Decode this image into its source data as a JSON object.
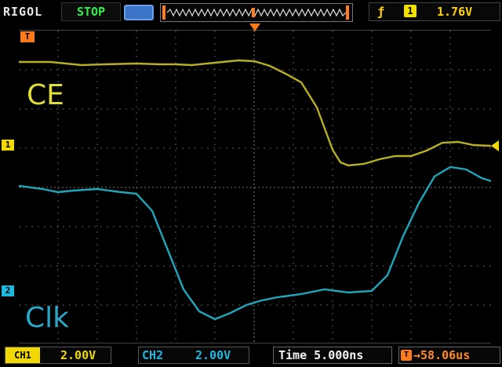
{
  "header": {
    "brand": "RIGOL",
    "run_state": "STOP",
    "trigger": {
      "edge_icon": "rising-edge-icon",
      "channel": "1",
      "level": "1.76V"
    }
  },
  "markers": {
    "trigger_marker": "T",
    "ch1_marker": "1",
    "ch2_marker": "2"
  },
  "traces": {
    "ch1": {
      "name": "CE",
      "color": "#b7b024"
    },
    "ch2": {
      "name": "Clk",
      "color": "#1ea6bb"
    }
  },
  "footer": {
    "ch1_tag": "CH1",
    "ch1_scale": "2.00V",
    "ch2_tag": "CH2",
    "ch2_scale": "2.00V",
    "time_label": "Time",
    "timebase": "5.000ns",
    "trigger_offset_tag": "T",
    "trigger_offset": "→58.06us"
  },
  "colors": {
    "ch1": "#f0d800",
    "ch2": "#1fb8de",
    "accent_trigger": "#ff7a1a",
    "grid": "#5b5b5b"
  }
}
